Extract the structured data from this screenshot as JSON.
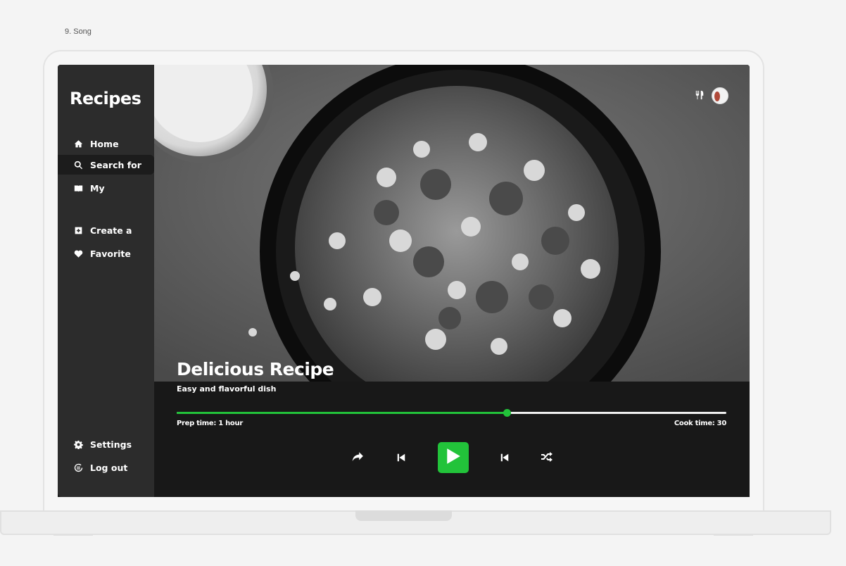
{
  "frame_label": "9. Song",
  "sidebar": {
    "brand": "Recipes",
    "items": [
      {
        "label": "Home",
        "icon": "home-icon"
      },
      {
        "label": "Search for",
        "icon": "search-icon",
        "active": true
      },
      {
        "label": "My",
        "icon": "book-icon"
      },
      {
        "label": "Create a",
        "icon": "plus-square-icon"
      },
      {
        "label": "Favorite",
        "icon": "heart-icon"
      }
    ],
    "bottom": [
      {
        "label": "Settings",
        "icon": "gear-icon"
      },
      {
        "label": "Log out",
        "icon": "logout-icon"
      }
    ]
  },
  "hero": {
    "title": "Delicious Recipe",
    "top_icons": [
      "cutlery-icon",
      "avatar"
    ]
  },
  "player": {
    "subtitle": "Easy and flavorful dish",
    "progress_fraction": 0.6,
    "prep_time": "Prep time: 1 hour",
    "cook_time": "Cook time: 30",
    "controls": [
      "share-icon",
      "previous-icon",
      "play-icon",
      "next-icon",
      "shuffle-icon"
    ]
  },
  "colors": {
    "accent": "#22c33a",
    "sidebar_bg": "#2c2c2c",
    "player_bg": "#181818"
  }
}
